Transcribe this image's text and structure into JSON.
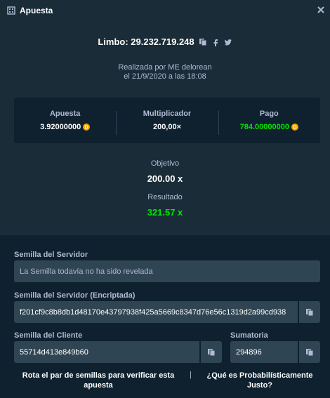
{
  "header": {
    "title": "Apuesta"
  },
  "bet": {
    "game_title": "Limbo: 29.232.719.248",
    "placed_by": "Realizada por ME delorean",
    "placed_at": "el 21/9/2020 a las 18:08"
  },
  "stats": {
    "bet_label": "Apuesta",
    "bet_value": "3.92000000",
    "multiplier_label": "Multiplicador",
    "multiplier_value": "200,00×",
    "payout_label": "Pago",
    "payout_value": "784.00000000"
  },
  "result": {
    "target_label": "Objetivo",
    "target_value": "200.00 x",
    "result_label": "Resultado",
    "result_value": "321.57 x"
  },
  "seeds": {
    "server_label": "Semilla del Servidor",
    "server_value": "La Semilla todavía no ha sido revelada",
    "server_hashed_label": "Semilla del Servidor (Encriptada)",
    "server_hashed_value": "f201cf9c8b8db1d48170e43797938f425a5669c8347d76e56c1319d2a99cd938",
    "client_label": "Semilla del Cliente",
    "client_value": "55714d413e849b60",
    "nonce_label": "Sumatoria",
    "nonce_value": "294896"
  },
  "links": {
    "rotate": "Rota el par de semillas para verificar esta apuesta",
    "separator": "|",
    "provably_fair": "¿Qué es Probabilísticamente Justo?"
  },
  "colors": {
    "background": "#1a2c38",
    "panel": "#0f212e",
    "input": "#2f4553",
    "win": "#00e701",
    "coin": "#f7a600"
  }
}
